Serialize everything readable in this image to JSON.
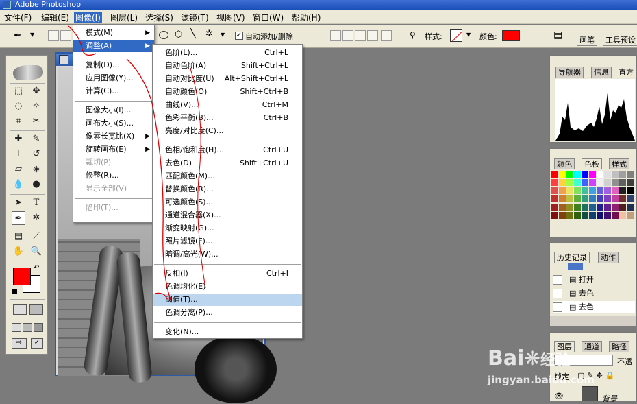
{
  "app": {
    "title": "Adobe Photoshop"
  },
  "menubar": [
    "文件(F)",
    "编辑(E)",
    "图像(I)",
    "图层(L)",
    "选择(S)",
    "滤镜(T)",
    "视图(V)",
    "窗口(W)",
    "帮助(H)"
  ],
  "options": {
    "auto_add_delete": "自动添加/删除",
    "style_label": "样式:",
    "color_label": "颜色:",
    "color": "#ff0000",
    "brush_tab": "画笔",
    "tool_preset_tab": "工具预设"
  },
  "image_menu": [
    {
      "label": "模式(M)",
      "submenu": true
    },
    {
      "label": "调整(A)",
      "submenu": true,
      "active": true
    },
    {
      "sep": true
    },
    {
      "label": "复制(D)..."
    },
    {
      "label": "应用图像(Y)..."
    },
    {
      "label": "计算(C)..."
    },
    {
      "sep": true
    },
    {
      "label": "图像大小(I)..."
    },
    {
      "label": "画布大小(S)..."
    },
    {
      "label": "像素长宽比(X)",
      "submenu": true
    },
    {
      "label": "旋转画布(E)",
      "submenu": true
    },
    {
      "label": "裁切(P)",
      "disabled": true
    },
    {
      "label": "修整(R)..."
    },
    {
      "label": "显示全部(V)",
      "disabled": true
    },
    {
      "sep": true
    },
    {
      "label": "陷印(T)...",
      "disabled": true
    }
  ],
  "adjust_menu": [
    {
      "label": "色阶(L)...",
      "shortcut": "Ctrl+L"
    },
    {
      "label": "自动色阶(A)",
      "shortcut": "Shift+Ctrl+L"
    },
    {
      "label": "自动对比度(U)",
      "shortcut": "Alt+Shift+Ctrl+L"
    },
    {
      "label": "自动颜色(O)",
      "shortcut": "Shift+Ctrl+B"
    },
    {
      "label": "曲线(V)...",
      "shortcut": "Ctrl+M"
    },
    {
      "label": "色彩平衡(B)...",
      "shortcut": "Ctrl+B"
    },
    {
      "label": "亮度/对比度(C)..."
    },
    {
      "sep": true
    },
    {
      "label": "色相/饱和度(H)...",
      "shortcut": "Ctrl+U"
    },
    {
      "label": "去色(D)",
      "shortcut": "Shift+Ctrl+U"
    },
    {
      "label": "匹配颜色(M)..."
    },
    {
      "label": "替换颜色(R)..."
    },
    {
      "label": "可选颜色(S)..."
    },
    {
      "label": "通道混合器(X)..."
    },
    {
      "label": "渐变映射(G)..."
    },
    {
      "label": "照片滤镜(F)..."
    },
    {
      "label": "暗调/高光(W)..."
    },
    {
      "sep": true
    },
    {
      "label": "反相(I)",
      "shortcut": "Ctrl+I"
    },
    {
      "label": "色调均化(E)"
    },
    {
      "label": "阈值(T)...",
      "highlight": true
    },
    {
      "label": "色调分离(P)..."
    },
    {
      "sep": true
    },
    {
      "label": "变化(N)..."
    }
  ],
  "navigator": {
    "tabs": [
      "导航器",
      "信息",
      "直方"
    ]
  },
  "swatches": {
    "tabs": [
      "颜色",
      "色板",
      "样式"
    ]
  },
  "history": {
    "tabs": [
      "历史记录",
      "动作"
    ],
    "items": [
      "打开",
      "去色",
      "去色"
    ]
  },
  "layers": {
    "tabs": [
      "图层",
      "通道",
      "路径"
    ],
    "opacity_label": "不透",
    "lock_label": "锁定",
    "layer_name": "背景"
  },
  "watermark": {
    "brand": "Bai",
    "brand2": "经验",
    "url": "jingyan.baidu.com"
  }
}
